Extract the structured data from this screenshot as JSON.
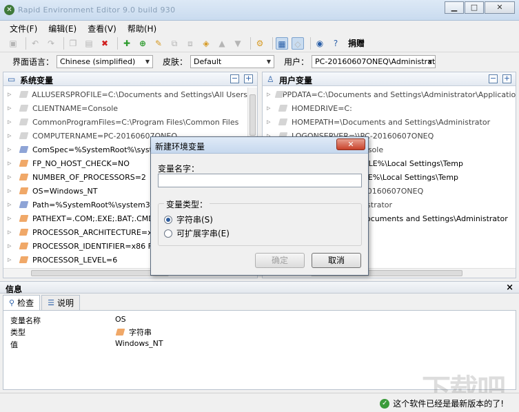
{
  "window": {
    "title": "Rapid Environment Editor 9.0 build 930",
    "minimize": "▁",
    "maximize": "□",
    "close": "✕"
  },
  "menu": [
    "文件(F)",
    "编辑(E)",
    "查看(V)",
    "帮助(H)"
  ],
  "toolbar": {
    "donate_label": "捐赠"
  },
  "options": {
    "language_label": "界面语言：",
    "language_value": "Chinese (simplified)",
    "skin_label": "皮肤：",
    "skin_value": "Default",
    "user_label": "用户：",
    "user_value": "PC-20160607ONEQ\\Administrato"
  },
  "system_pane": {
    "title": "系统变量",
    "items": [
      "ALLUSERSPROFILE=C:\\Documents and Settings\\All Users",
      "CLIENTNAME=Console",
      "CommonProgramFiles=C:\\Program Files\\Common Files",
      "COMPUTERNAME=PC-20160607ONEQ",
      "ComSpec=%SystemRoot%\\system32\\cmd.exe",
      "FP_NO_HOST_CHECK=NO",
      "NUMBER_OF_PROCESSORS=2",
      "OS=Windows_NT",
      "Path=%SystemRoot%\\system32;%SystemRoot%",
      "PATHEXT=.COM;.EXE;.BAT;.CMD;.VBS",
      "PROCESSOR_ARCHITECTURE=x86",
      "PROCESSOR_IDENTIFIER=x86 Family 6",
      "PROCESSOR_LEVEL=6"
    ]
  },
  "user_pane": {
    "title": "用户变量",
    "items": [
      "APPDATA=C:\\Documents and Settings\\Administrator\\Application Da",
      "HOMEDRIVE=C:",
      "HOMEPATH=\\Documents and Settings\\Administrator",
      "LOGONSERVER=\\\\PC-20160607ONEQ",
      "SESSIONNAME=Console",
      "TEMP=%USERPROFILE%\\Local Settings\\Temp",
      "TMP=%USERPROFILE%\\Local Settings\\Temp",
      "USERDOMAIN=PC-20160607ONEQ",
      "USERNAME=Administrator",
      "USERPROFILE=C:\\Documents and Settings\\Administrator"
    ]
  },
  "info": {
    "title": "信息",
    "close": "×",
    "tabs": [
      "检查",
      "说明"
    ],
    "rows": [
      {
        "key": "变量名称",
        "value": "OS"
      },
      {
        "key": "类型",
        "value": "字符串"
      },
      {
        "key": "值",
        "value": "Windows_NT"
      }
    ]
  },
  "status": {
    "message": "这个软件已经是最新版本的了!"
  },
  "watermark": "下载吧",
  "dialog": {
    "title": "新建环境变量",
    "close": "✕",
    "name_label": "变量名字：",
    "name_value": "",
    "type_group_label": "变量类型：",
    "radio_string": "字符串(S)",
    "radio_expand": "可扩展字串(E)",
    "ok": "确定",
    "cancel": "取消"
  }
}
